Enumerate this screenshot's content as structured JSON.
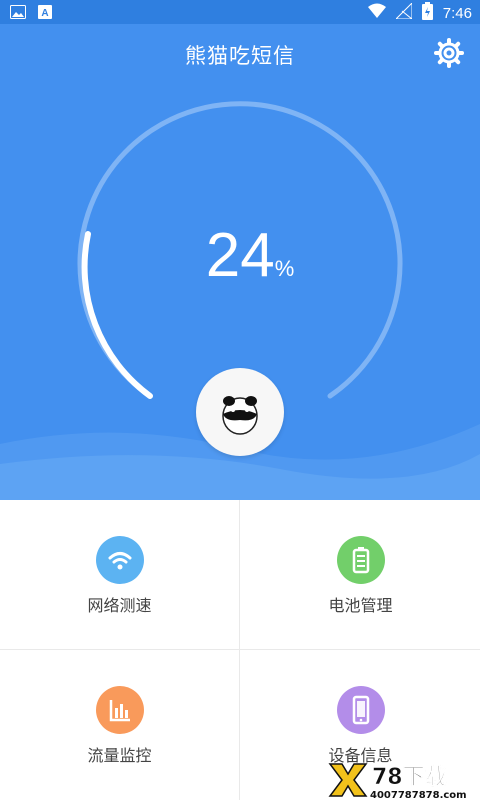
{
  "status_bar": {
    "time": "7:46",
    "icons": [
      "image-icon",
      "a-icon",
      "wifi-icon",
      "signal-icon",
      "battery-icon"
    ]
  },
  "header": {
    "title": "熊猫吃短信",
    "settings_icon": "gear-icon"
  },
  "gauge": {
    "value": "24",
    "unit": "%",
    "progress_fraction": 0.24
  },
  "features": [
    {
      "label": "网络测速",
      "icon": "wifi-icon",
      "color": "#5cb3f2"
    },
    {
      "label": "电池管理",
      "icon": "battery-icon",
      "color": "#72cf6a"
    },
    {
      "label": "流量监控",
      "icon": "bar-chart-icon",
      "color": "#f99a5b"
    },
    {
      "label": "设备信息",
      "icon": "phone-icon",
      "color": "#b38de9"
    }
  ],
  "watermark": {
    "brand": "78下载",
    "url": "4007787878.com"
  },
  "colors": {
    "primary": "#4390ef",
    "status_bar": "#2f7fe0"
  }
}
